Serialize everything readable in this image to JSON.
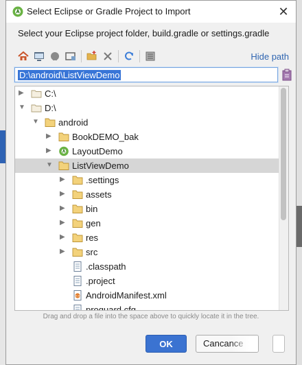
{
  "window": {
    "title": "Select Eclipse or Gradle Project to Import"
  },
  "dialog": {
    "prompt": "Select your Eclipse project folder, build.gradle or settings.gradle"
  },
  "toolbar": {
    "icons": [
      "home-icon",
      "desktop-icon",
      "android-icon",
      "module-icon",
      "new-folder-icon",
      "delete-icon",
      "refresh-icon",
      "show-hidden-icon"
    ],
    "hide_path_label": "Hide path"
  },
  "path_field": {
    "value": "D:\\android\\ListViewDemo"
  },
  "tree": {
    "items": [
      {
        "label": "C:\\",
        "depth": 0,
        "arrow": "collapsed",
        "icon": "drive",
        "selected": false
      },
      {
        "label": "D:\\",
        "depth": 0,
        "arrow": "expanded",
        "icon": "drive",
        "selected": false
      },
      {
        "label": "android",
        "depth": 1,
        "arrow": "expanded",
        "icon": "folder",
        "selected": false
      },
      {
        "label": "BookDEMO_bak",
        "depth": 2,
        "arrow": "collapsed",
        "icon": "folder",
        "selected": false
      },
      {
        "label": "LayoutDemo",
        "depth": 2,
        "arrow": "collapsed",
        "icon": "android",
        "selected": false
      },
      {
        "label": "ListViewDemo",
        "depth": 2,
        "arrow": "expanded",
        "icon": "folder",
        "selected": true
      },
      {
        "label": ".settings",
        "depth": 3,
        "arrow": "collapsed",
        "icon": "folder",
        "selected": false
      },
      {
        "label": "assets",
        "depth": 3,
        "arrow": "collapsed",
        "icon": "folder",
        "selected": false
      },
      {
        "label": "bin",
        "depth": 3,
        "arrow": "collapsed",
        "icon": "folder",
        "selected": false
      },
      {
        "label": "gen",
        "depth": 3,
        "arrow": "collapsed",
        "icon": "folder",
        "selected": false
      },
      {
        "label": "res",
        "depth": 3,
        "arrow": "collapsed",
        "icon": "folder",
        "selected": false
      },
      {
        "label": "src",
        "depth": 3,
        "arrow": "collapsed",
        "icon": "folder",
        "selected": false
      },
      {
        "label": ".classpath",
        "depth": 3,
        "arrow": "none",
        "icon": "file",
        "selected": false
      },
      {
        "label": ".project",
        "depth": 3,
        "arrow": "none",
        "icon": "file",
        "selected": false
      },
      {
        "label": "AndroidManifest.xml",
        "depth": 3,
        "arrow": "none",
        "icon": "xml",
        "selected": false
      },
      {
        "label": "proguard.cfg",
        "depth": 3,
        "arrow": "none",
        "icon": "file",
        "selected": false
      }
    ]
  },
  "hint": "Drag and drop a file into the space above to quickly locate it in the tree.",
  "buttons": {
    "ok": "OK",
    "cancel": "Cancance"
  },
  "colors": {
    "accent": "#3b73d1",
    "link": "#2f65b1",
    "selection": "#d6d6d6",
    "folder": "#e8c46a"
  }
}
